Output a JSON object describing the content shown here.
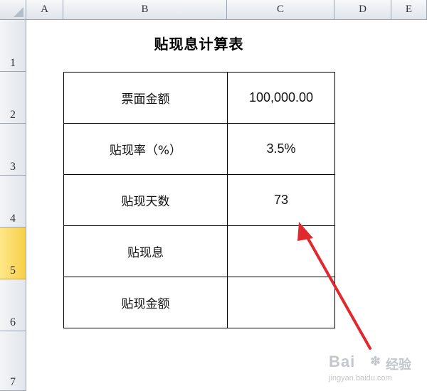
{
  "columns": [
    "A",
    "B",
    "C",
    "D",
    "E"
  ],
  "rows": [
    "1",
    "2",
    "3",
    "4",
    "5",
    "6",
    "7"
  ],
  "selected_row": "5",
  "title": "贴现息计算表",
  "table": [
    {
      "label": "票面金额",
      "value": "100,000.00"
    },
    {
      "label": "贴现率（%）",
      "value": "3.5%"
    },
    {
      "label": "贴现天数",
      "value": "73"
    },
    {
      "label": "贴现息",
      "value": ""
    },
    {
      "label": "贴现金额",
      "value": ""
    }
  ],
  "annotation": {
    "arrow_color": "#e0282e",
    "icon": "red-arrow-icon"
  },
  "watermark": {
    "logo": "Bai",
    "logo_suffix": "经验",
    "url": "jingyan.baidu.com",
    "icon": "paw-icon"
  }
}
